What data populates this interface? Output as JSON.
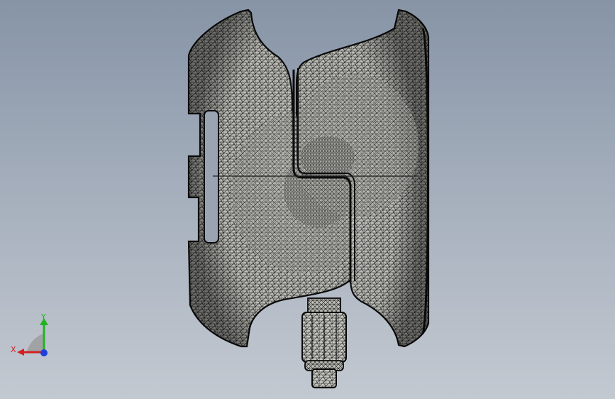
{
  "viewport": {
    "background_top": "#8694a6",
    "background_bottom": "#c3c9d1"
  },
  "model": {
    "mesh_fill": "#c9c9c4",
    "mesh_line": "#1c1c1c",
    "edge_color": "#0a0a0a"
  },
  "triad": {
    "x_label": "X",
    "y_label": "Y",
    "x_color": "#d42020",
    "y_color": "#22b222",
    "z_color": "#1f3fd8",
    "shadow_color": "#9a9a9a"
  }
}
